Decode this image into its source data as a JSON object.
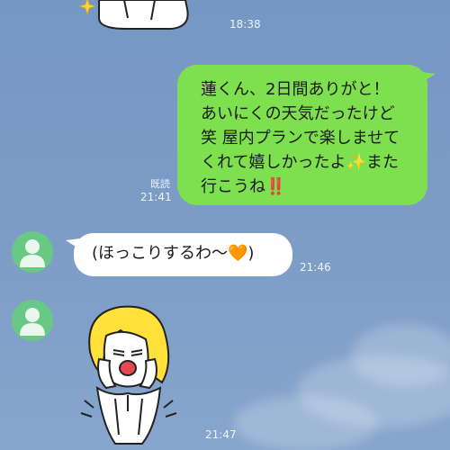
{
  "messages": {
    "top_timestamp": "18:38",
    "outgoing": {
      "lines": [
        "蓮くん、2日間ありがと！",
        "あいにくの天気だったけど",
        "笑 屋内プランで楽しませて",
        "くれて嬉しかったよ✨また",
        "行こうね‼️"
      ],
      "read_label": "既読",
      "timestamp": "21:41"
    },
    "incoming_text": {
      "text": "(ほっこりするわ〜🧡)",
      "timestamp": "21:46"
    },
    "incoming_sticker": {
      "timestamp": "21:47"
    }
  },
  "icons": {
    "avatar": "default-person-avatar-icon",
    "sparkle": "sparkle-icon"
  },
  "colors": {
    "background": "#7b9bc6",
    "outgoing_bubble": "#7ee04e",
    "incoming_bubble": "#ffffff",
    "avatar": "#68c884",
    "sticker_hair": "#ffe13a"
  }
}
